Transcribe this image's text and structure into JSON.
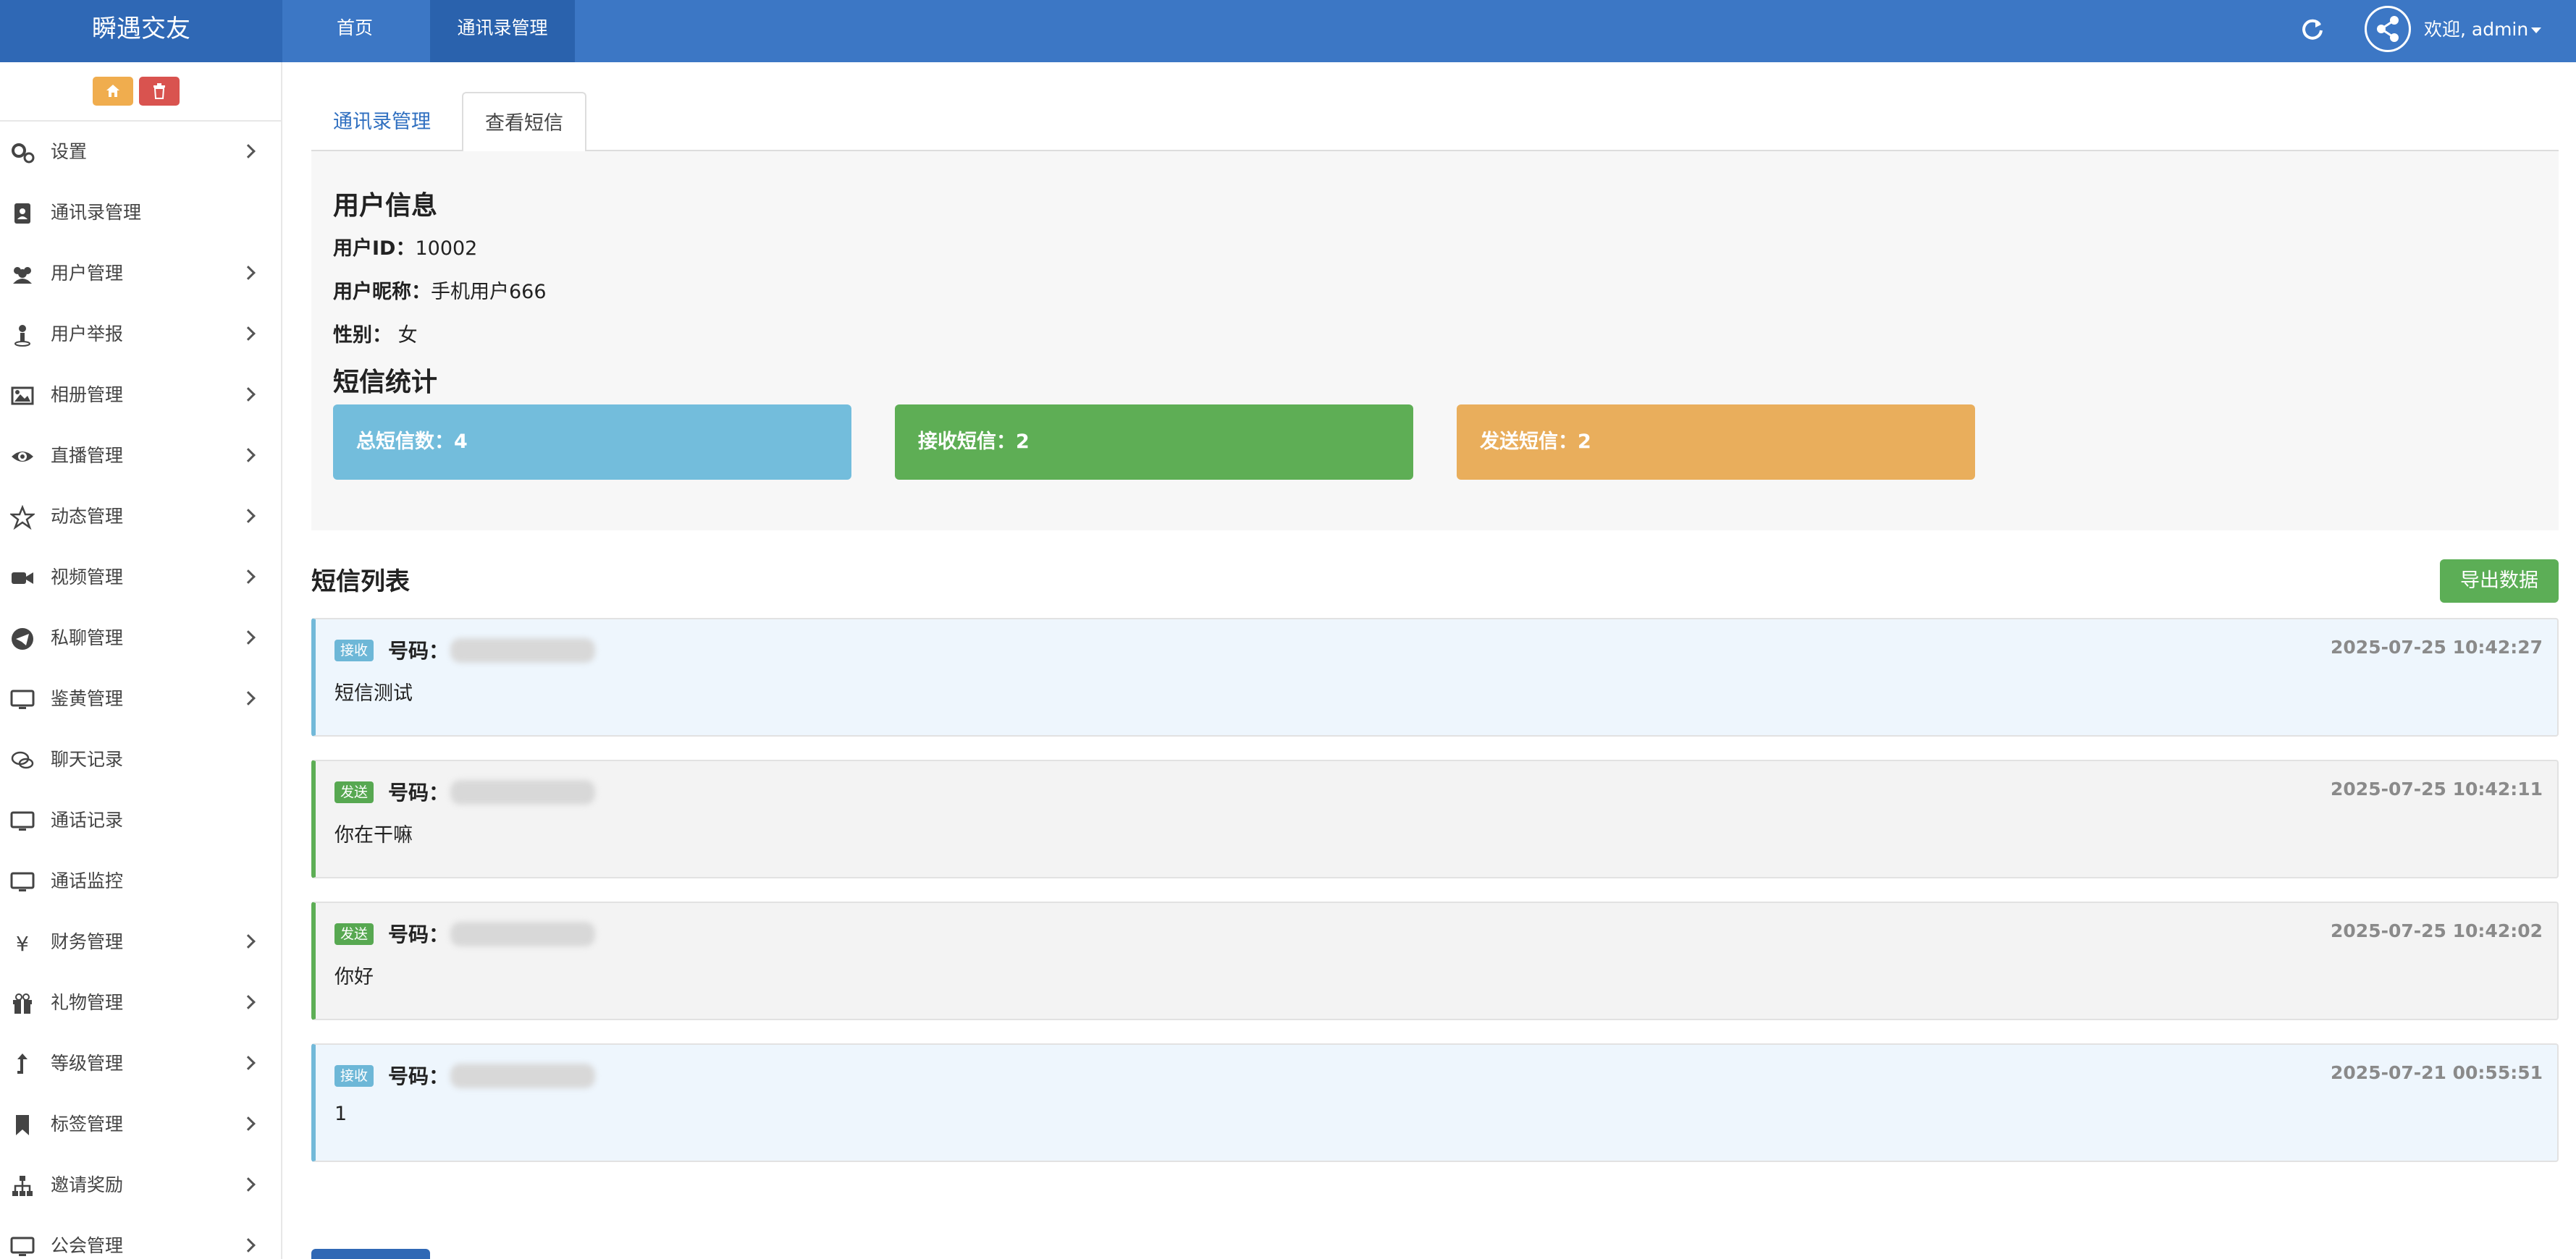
{
  "navbar": {
    "brand": "瞬遇交友",
    "links": [
      "首页",
      "通讯录管理"
    ],
    "welcome": "欢迎, admin"
  },
  "sidebar": {
    "items": [
      {
        "label": "设置",
        "icon": "gears-icon",
        "has_sub": true
      },
      {
        "label": "通讯录管理",
        "icon": "address-book-icon",
        "has_sub": false
      },
      {
        "label": "用户管理",
        "icon": "users-icon",
        "has_sub": true
      },
      {
        "label": "用户举报",
        "icon": "report-icon",
        "has_sub": true
      },
      {
        "label": "相册管理",
        "icon": "image-icon",
        "has_sub": true
      },
      {
        "label": "直播管理",
        "icon": "eye-icon",
        "has_sub": true
      },
      {
        "label": "动态管理",
        "icon": "star-icon",
        "has_sub": true
      },
      {
        "label": "视频管理",
        "icon": "video-icon",
        "has_sub": true
      },
      {
        "label": "私聊管理",
        "icon": "telegram-icon",
        "has_sub": true
      },
      {
        "label": "鉴黄管理",
        "icon": "desktop-icon",
        "has_sub": true
      },
      {
        "label": "聊天记录",
        "icon": "comments-icon",
        "has_sub": false
      },
      {
        "label": "通话记录",
        "icon": "desktop-icon",
        "has_sub": false
      },
      {
        "label": "通话监控",
        "icon": "desktop-icon",
        "has_sub": false
      },
      {
        "label": "财务管理",
        "icon": "yen-icon",
        "has_sub": true
      },
      {
        "label": "礼物管理",
        "icon": "gift-icon",
        "has_sub": true
      },
      {
        "label": "等级管理",
        "icon": "level-up-icon",
        "has_sub": true
      },
      {
        "label": "标签管理",
        "icon": "bookmark-icon",
        "has_sub": true
      },
      {
        "label": "邀请奖励",
        "icon": "sitemap-icon",
        "has_sub": true
      },
      {
        "label": "公会管理",
        "icon": "desktop-icon",
        "has_sub": true
      }
    ]
  },
  "tabs": [
    "通讯录管理",
    "查看短信"
  ],
  "user_info": {
    "heading": "用户信息",
    "id_label": "用户ID：",
    "id_value": "10002",
    "nick_label": "用户昵称：",
    "nick_value": "手机用户666",
    "gender_label": "性别：",
    "gender_value": "女"
  },
  "stats": {
    "heading": "短信统计",
    "total": "总短信数：4",
    "received": "接收短信：2",
    "sent": "发送短信：2"
  },
  "list": {
    "title": "短信列表",
    "export_label": "导出数据",
    "number_label": "号码：",
    "messages": [
      {
        "type": "recv",
        "badge": "接收",
        "time": "2025-07-25 10:42:27",
        "text": "短信测试"
      },
      {
        "type": "send",
        "badge": "发送",
        "time": "2025-07-25 10:42:11",
        "text": "你在干嘛"
      },
      {
        "type": "send",
        "badge": "发送",
        "time": "2025-07-25 10:42:02",
        "text": "你好"
      },
      {
        "type": "recv",
        "badge": "接收",
        "time": "2025-07-21 00:55:51",
        "text": "1"
      }
    ]
  },
  "colors": {
    "navbar": "#3c77c5",
    "brand_bg": "#2f68b5",
    "stat_total": "#73bddc",
    "stat_received": "#5eae55",
    "stat_sent": "#e9ae5c",
    "export_button": "#5cae56"
  }
}
